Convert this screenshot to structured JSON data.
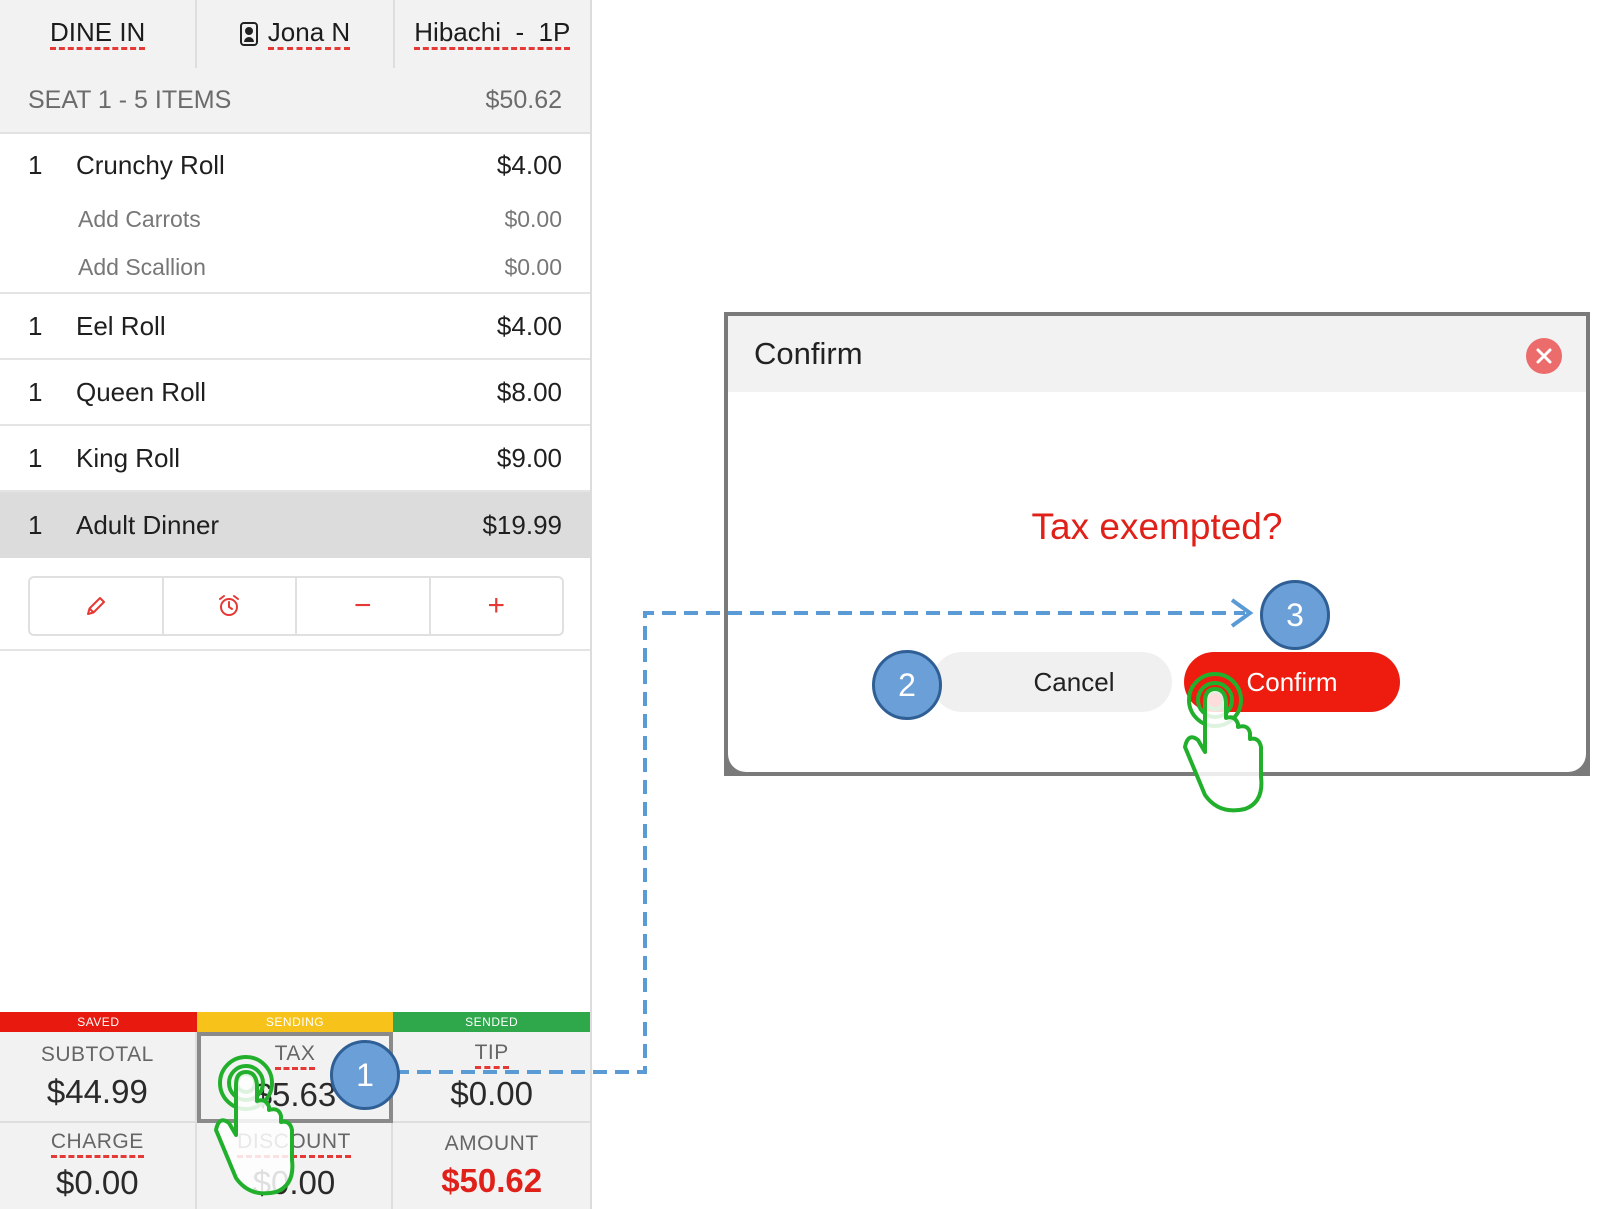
{
  "topbar": {
    "order_type": "DINE IN",
    "server": "Jona N",
    "table": "Hibachi  -  1P"
  },
  "seat": {
    "label": "SEAT 1 - 5 ITEMS",
    "total": "$50.62"
  },
  "items": [
    {
      "qty": "1",
      "name": "Crunchy Roll",
      "price": "$4.00",
      "modifiers": [
        {
          "name": "Add Carrots",
          "price": "$0.00"
        },
        {
          "name": "Add Scallion",
          "price": "$0.00"
        }
      ]
    },
    {
      "qty": "1",
      "name": "Eel Roll",
      "price": "$4.00"
    },
    {
      "qty": "1",
      "name": "Queen Roll",
      "price": "$8.00"
    },
    {
      "qty": "1",
      "name": "King Roll",
      "price": "$9.00"
    },
    {
      "qty": "1",
      "name": "Adult Dinner",
      "price": "$19.99",
      "selected": true
    }
  ],
  "actions": {
    "edit_icon": "pencil-icon",
    "timer_icon": "alarm-clock-icon",
    "minus": "−",
    "plus": "+"
  },
  "status": {
    "saved": "SAVED",
    "sending": "SENDING",
    "sended": "SENDED",
    "colors": {
      "saved": "#e8190e",
      "sending": "#f7c31b",
      "sended": "#2ea84a"
    }
  },
  "totals": {
    "subtotal_label": "SUBTOTAL",
    "subtotal": "$44.99",
    "tax_label": "TAX",
    "tax": "$5.63",
    "tip_label": "TIP",
    "tip": "$0.00",
    "charge_label": "CHARGE",
    "charge": "$0.00",
    "discount_label": "DISCOUNT",
    "discount": "$0.00",
    "amount_label": "AMOUNT",
    "amount": "$50.62"
  },
  "dialog": {
    "title": "Confirm",
    "message": "Tax exempted?",
    "cancel_label": "Cancel",
    "confirm_label": "Confirm"
  },
  "annotations": {
    "step1": "1",
    "step2": "2",
    "step3": "3",
    "pointer_icon": "tap-hand-icon"
  }
}
